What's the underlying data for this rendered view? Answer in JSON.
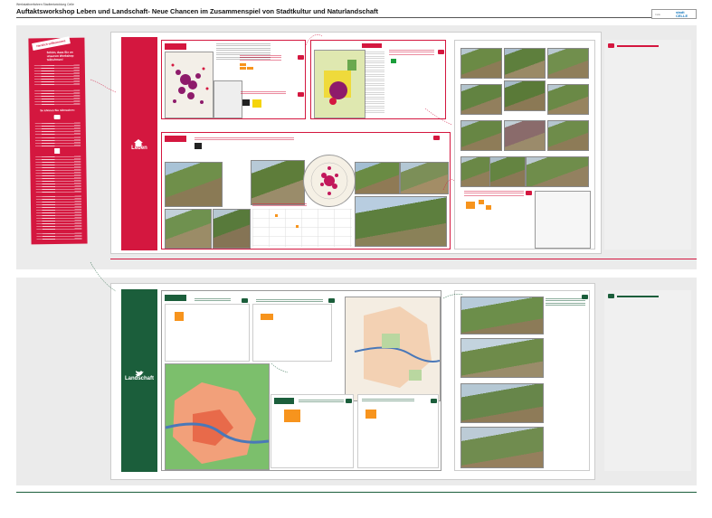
{
  "header": {
    "subtitle": "Werkstattverfahren Stadtentwicklung Celle",
    "title": "Auftaktsworkshop Leben und Landschaft- Neue Chancen im Zusammenspiel von Stadtkultur und Naturlandschaft",
    "logo_text": "stadt CELLE",
    "logo_small": "Celle"
  },
  "intro": {
    "badge": "Herzlich willkommen!",
    "heading": "Schön, dass Sie an unserem Workshop teilnehmen!",
    "how_heading": "So können Sie mitmachen:"
  },
  "sections": {
    "leben": {
      "label": "Leben"
    },
    "landschaft": {
      "label": "Landschaft"
    }
  },
  "colors": {
    "leben": "#d4173f",
    "landschaft": "#1b5e3b",
    "accent_note": "#f7941d"
  },
  "icons": {
    "leben": "home-icon",
    "landschaft": "bird-icon"
  }
}
